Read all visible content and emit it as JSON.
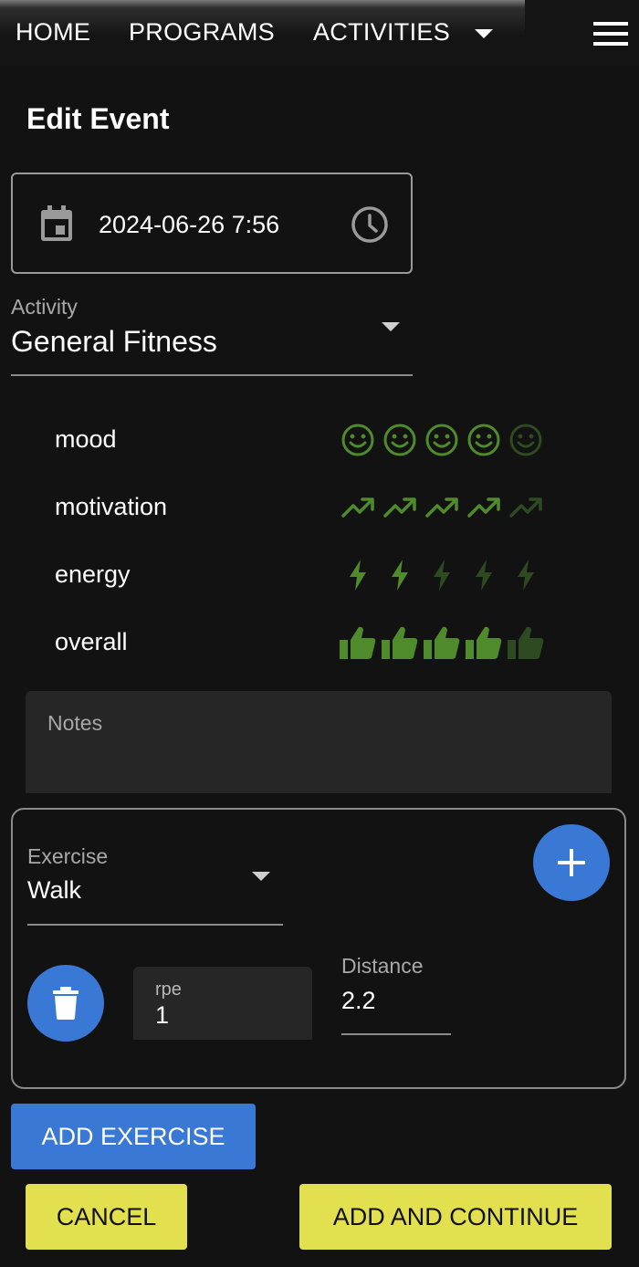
{
  "nav": {
    "home": "HOME",
    "programs": "PROGRAMS",
    "activities": "ACTIVITIES"
  },
  "page": {
    "title": "Edit Event"
  },
  "datetime": {
    "value": "2024-06-26 7:56"
  },
  "activity": {
    "label": "Activity",
    "value": "General Fitness"
  },
  "ratings": {
    "active_color": "#4f8a2b",
    "inactive_color": "#2e4a21",
    "items": [
      {
        "label": "mood",
        "icon": "smiley-icon",
        "value": 4,
        "max": 5
      },
      {
        "label": "motivation",
        "icon": "trending-up-icon",
        "value": 4,
        "max": 5
      },
      {
        "label": "energy",
        "icon": "lightning-bolt-icon",
        "value": 2,
        "max": 5
      },
      {
        "label": "overall",
        "icon": "thumbs-up-icon",
        "value": 4,
        "max": 5
      }
    ]
  },
  "notes": {
    "placeholder": "Notes"
  },
  "exercise": {
    "label": "Exercise",
    "value": "Walk",
    "rpe_label": "rpe",
    "rpe_value": "1",
    "distance_label": "Distance",
    "distance_value": "2.2"
  },
  "buttons": {
    "add_exercise": "ADD EXERCISE",
    "cancel": "CANCEL",
    "add_and_continue": "ADD AND CONTINUE"
  },
  "colors": {
    "background": "#121212",
    "accent_blue": "#3a78d6",
    "accent_yellow": "#e2e04e"
  }
}
